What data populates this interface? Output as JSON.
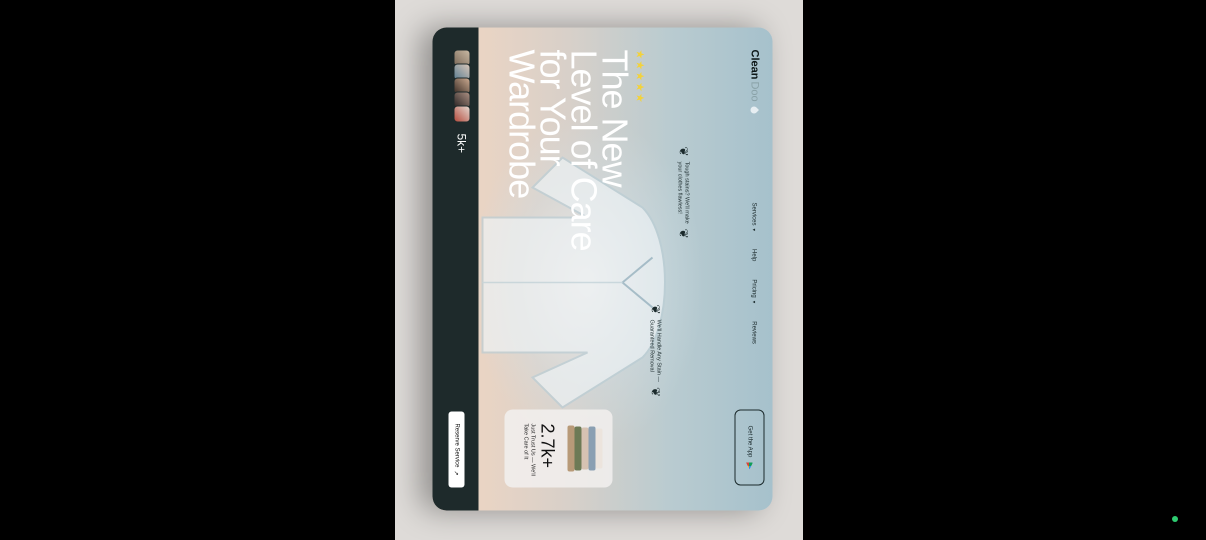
{
  "brand": {
    "name_bold": "Clean",
    "name_light": "Doo"
  },
  "nav": {
    "items": [
      {
        "label": "Services",
        "has_caret": true
      },
      {
        "label": "Help",
        "has_caret": false
      },
      {
        "label": "Pricing",
        "has_caret": true
      },
      {
        "label": "Reviews",
        "has_caret": false
      }
    ],
    "cta_label": "Get the App"
  },
  "quotes": [
    {
      "line1": "Tough stains? We'll make",
      "line2": "your clothes flawless!"
    },
    {
      "line1": "We'll Handle Any Stain —",
      "line2": "Guaranteed Removal"
    }
  ],
  "rating": {
    "stars": "★★★★★",
    "value": 5
  },
  "hero": {
    "line1": "The New",
    "line2": "Level of Care",
    "line3": "for Your",
    "line4": "Wardrobe"
  },
  "promo": {
    "number": "2.7k+",
    "text": "Just Trust Us — We'll Take Care of It"
  },
  "social": {
    "count": "5k+"
  },
  "reserve": {
    "label": "Reserve Service",
    "arrow": "↗"
  },
  "colors": {
    "dark_bar": "#1e2a2b",
    "star": "#f3d23a",
    "status_dot": "#2ecc71"
  }
}
